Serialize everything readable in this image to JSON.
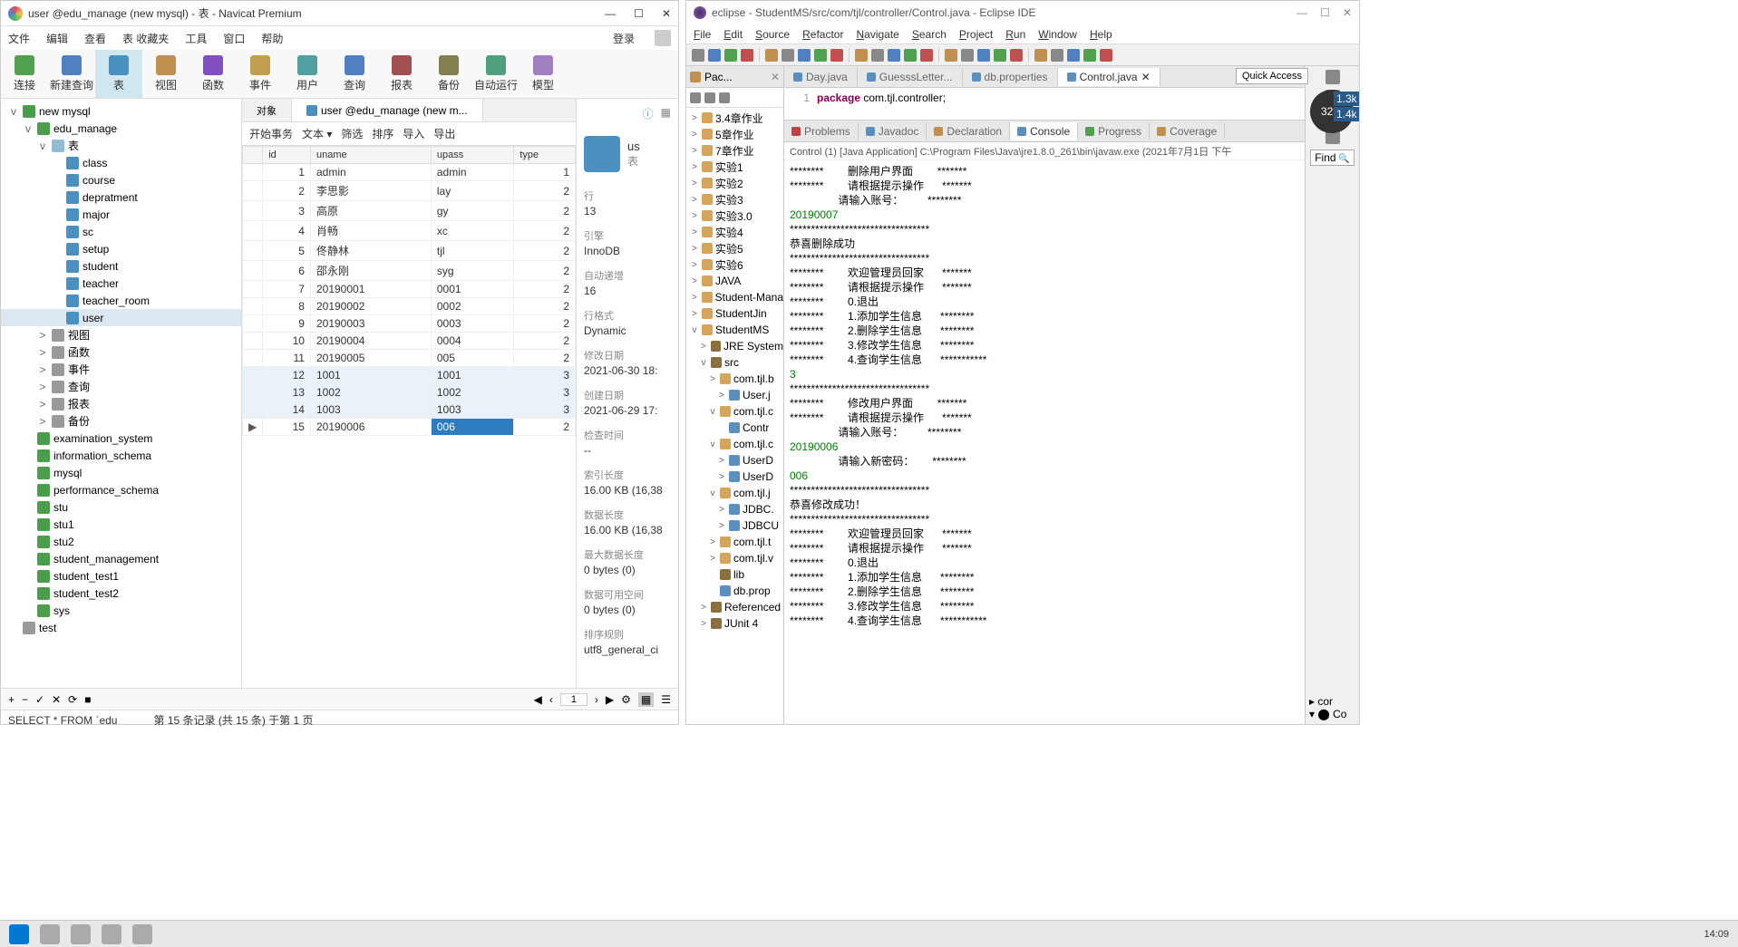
{
  "navicat": {
    "title": "user @edu_manage (new mysql) - 表 - Navicat Premium",
    "menu": [
      "文件",
      "编辑",
      "查看",
      "表 收藏夹",
      "工具",
      "窗口",
      "帮助"
    ],
    "login": "登录",
    "toolbar": [
      {
        "label": "连接"
      },
      {
        "label": "新建查询"
      },
      {
        "label": "表",
        "active": true
      },
      {
        "label": "视图"
      },
      {
        "label": "函数"
      },
      {
        "label": "事件"
      },
      {
        "label": "用户"
      },
      {
        "label": "查询"
      },
      {
        "label": "报表"
      },
      {
        "label": "备份"
      },
      {
        "label": "自动运行"
      },
      {
        "label": "模型"
      }
    ],
    "tree_root": {
      "label": "new mysql",
      "exp": "v"
    },
    "tree_db": {
      "label": "edu_manage",
      "exp": "v"
    },
    "tree_tables_folder": {
      "label": "表",
      "exp": "v"
    },
    "tree_tables": [
      "class",
      "course",
      "depratment",
      "major",
      "sc",
      "setup",
      "student",
      "teacher",
      "teacher_room",
      "user"
    ],
    "tree_selected": "user",
    "tree_groups": [
      "视图",
      "函数",
      "事件",
      "查询",
      "报表",
      "备份"
    ],
    "tree_other_dbs": [
      "examination_system",
      "information_schema",
      "mysql",
      "performance_schema",
      "stu",
      "stu1",
      "stu2",
      "student_management",
      "student_test1",
      "student_test2",
      "sys"
    ],
    "tree_last": "test",
    "center": {
      "tab_obj": "对象",
      "tab_data": "user @edu_manage (new m...",
      "subtb": [
        "开始事务",
        "文本 ▾",
        "筛选",
        "排序",
        "导入",
        "导出"
      ],
      "columns": [
        "id",
        "uname",
        "upass",
        "type"
      ],
      "rows": [
        {
          "id": "1",
          "uname": "admin",
          "upass": "admin",
          "type": "1"
        },
        {
          "id": "2",
          "uname": "李思影",
          "upass": "lay",
          "type": "2"
        },
        {
          "id": "3",
          "uname": "高原",
          "upass": "gy",
          "type": "2"
        },
        {
          "id": "4",
          "uname": "肖畅",
          "upass": "xc",
          "type": "2"
        },
        {
          "id": "5",
          "uname": "佟静林",
          "upass": "tjl",
          "type": "2"
        },
        {
          "id": "6",
          "uname": "邵永刚",
          "upass": "syg",
          "type": "2"
        },
        {
          "id": "7",
          "uname": "20190001",
          "upass": "0001",
          "type": "2"
        },
        {
          "id": "8",
          "uname": "20190002",
          "upass": "0002",
          "type": "2"
        },
        {
          "id": "9",
          "uname": "20190003",
          "upass": "0003",
          "type": "2"
        },
        {
          "id": "10",
          "uname": "20190004",
          "upass": "0004",
          "type": "2"
        },
        {
          "id": "11",
          "uname": "20190005",
          "upass": "005",
          "type": "2"
        },
        {
          "id": "12",
          "uname": "1001",
          "upass": "1001",
          "type": "3"
        },
        {
          "id": "13",
          "uname": "1002",
          "upass": "1002",
          "type": "3"
        },
        {
          "id": "14",
          "uname": "1003",
          "upass": "1003",
          "type": "3"
        },
        {
          "id": "15",
          "uname": "20190006",
          "upass": "006",
          "type": "2"
        }
      ],
      "highlight_rows": [
        11,
        12,
        13
      ],
      "pointer_row": 14,
      "sel_cell": {
        "row": 14,
        "col": "upass"
      }
    },
    "right": {
      "title": "us",
      "sublabel": "表",
      "props": [
        {
          "lbl": "行",
          "val": "13"
        },
        {
          "lbl": "引擎",
          "val": "InnoDB"
        },
        {
          "lbl": "自动递增",
          "val": "16"
        },
        {
          "lbl": "行格式",
          "val": "Dynamic"
        },
        {
          "lbl": "修改日期",
          "val": "2021-06-30 18:"
        },
        {
          "lbl": "创建日期",
          "val": "2021-06-29 17:"
        },
        {
          "lbl": "检查时间",
          "val": "--"
        },
        {
          "lbl": "索引长度",
          "val": "16.00 KB (16,38"
        },
        {
          "lbl": "数据长度",
          "val": "16.00 KB (16,38"
        },
        {
          "lbl": "最大数据长度",
          "val": "0 bytes (0)"
        },
        {
          "lbl": "数据可用空间",
          "val": "0 bytes (0)"
        },
        {
          "lbl": "排序规则",
          "val": "utf8_general_ci"
        }
      ]
    },
    "bottom": {
      "page": "1"
    },
    "status": {
      "sql": "SELECT * FROM `edu",
      "info": "第 15 条记录 (共 15 条) 于第 1 页"
    }
  },
  "eclipse": {
    "title": "eclipse - StudentMS/src/com/tjl/controller/Control.java - Eclipse IDE",
    "menu": [
      "File",
      "Edit",
      "Source",
      "Refactor",
      "Navigate",
      "Search",
      "Project",
      "Run",
      "Window",
      "Help"
    ],
    "quick_access": "Quick Access",
    "lpanel": {
      "tab": "Pac..."
    },
    "etree": [
      {
        "lvl": 0,
        "exp": ">",
        "label": "3.4章作业",
        "icon": "pkg"
      },
      {
        "lvl": 0,
        "exp": ">",
        "label": "5章作业",
        "icon": "pkg"
      },
      {
        "lvl": 0,
        "exp": ">",
        "label": "7章作业",
        "icon": "pkg"
      },
      {
        "lvl": 0,
        "exp": ">",
        "label": "实验1",
        "icon": "pkg"
      },
      {
        "lvl": 0,
        "exp": ">",
        "label": "实验2",
        "icon": "pkg"
      },
      {
        "lvl": 0,
        "exp": ">",
        "label": "实验3",
        "icon": "pkg"
      },
      {
        "lvl": 0,
        "exp": ">",
        "label": "实验3.0",
        "icon": "pkg"
      },
      {
        "lvl": 0,
        "exp": ">",
        "label": "实验4",
        "icon": "pkg"
      },
      {
        "lvl": 0,
        "exp": ">",
        "label": "实验5",
        "icon": "pkg"
      },
      {
        "lvl": 0,
        "exp": ">",
        "label": "实验6",
        "icon": "pkg"
      },
      {
        "lvl": 0,
        "exp": ">",
        "label": "JAVA",
        "icon": "pkg"
      },
      {
        "lvl": 0,
        "exp": ">",
        "label": "Student-Mana",
        "icon": "pkg"
      },
      {
        "lvl": 0,
        "exp": ">",
        "label": "StudentJin",
        "icon": "pkg"
      },
      {
        "lvl": 0,
        "exp": "v",
        "label": "StudentMS",
        "icon": "pkg"
      },
      {
        "lvl": 1,
        "exp": ">",
        "label": "JRE System",
        "icon": "src"
      },
      {
        "lvl": 1,
        "exp": "v",
        "label": "src",
        "icon": "src"
      },
      {
        "lvl": 2,
        "exp": ">",
        "label": "com.tjl.b",
        "icon": "pkg"
      },
      {
        "lvl": 3,
        "exp": ">",
        "label": "User.j",
        "icon": "cls"
      },
      {
        "lvl": 2,
        "exp": "v",
        "label": "com.tjl.c",
        "icon": "pkg"
      },
      {
        "lvl": 3,
        "exp": "",
        "label": "Contr",
        "icon": "cls"
      },
      {
        "lvl": 2,
        "exp": "v",
        "label": "com.tjl.c",
        "icon": "pkg"
      },
      {
        "lvl": 3,
        "exp": ">",
        "label": "UserD",
        "icon": "cls"
      },
      {
        "lvl": 3,
        "exp": ">",
        "label": "UserD",
        "icon": "cls"
      },
      {
        "lvl": 2,
        "exp": "v",
        "label": "com.tjl.j",
        "icon": "pkg"
      },
      {
        "lvl": 3,
        "exp": ">",
        "label": "JDBC.",
        "icon": "cls"
      },
      {
        "lvl": 3,
        "exp": ">",
        "label": "JDBCU",
        "icon": "cls"
      },
      {
        "lvl": 2,
        "exp": ">",
        "label": "com.tjl.t",
        "icon": "pkg"
      },
      {
        "lvl": 2,
        "exp": ">",
        "label": "com.tjl.v",
        "icon": "pkg"
      },
      {
        "lvl": 2,
        "exp": "",
        "label": "lib",
        "icon": "src"
      },
      {
        "lvl": 2,
        "exp": "",
        "label": "db.prop",
        "icon": "cls"
      },
      {
        "lvl": 1,
        "exp": ">",
        "label": "Referenced",
        "icon": "src"
      },
      {
        "lvl": 1,
        "exp": ">",
        "label": "JUnit 4",
        "icon": "src"
      }
    ],
    "ed_tabs": [
      {
        "label": "Day.java"
      },
      {
        "label": "GuesssLetter..."
      },
      {
        "label": "db.properties"
      },
      {
        "label": "Control.java",
        "active": true
      }
    ],
    "editor_line_no": "1",
    "editor_kw": "package",
    "editor_rest": " com.tjl.controller;",
    "con_tabs": [
      {
        "label": "Problems",
        "color": "#c04040"
      },
      {
        "label": "Javadoc",
        "color": "#5a8fc0"
      },
      {
        "label": "Declaration",
        "color": "#c09050"
      },
      {
        "label": "Console",
        "color": "#5a8fc0",
        "active": true
      },
      {
        "label": "Progress",
        "color": "#50a050"
      },
      {
        "label": "Coverage",
        "color": "#c09050"
      }
    ],
    "con_header": "Control (1) [Java Application] C:\\Program Files\\Java\\jre1.8.0_261\\bin\\javaw.exe (2021年7月1日 下午",
    "console_lines": [
      {
        "t": "********        删除用户界面        *******"
      },
      {
        "t": "********        请根据提示操作      *******"
      },
      {
        "t": "                请输入账号：        ********"
      },
      {
        "t": "20190007",
        "cls": "inp"
      },
      {
        "t": "*********************************"
      },
      {
        "t": ""
      },
      {
        "t": "恭喜删除成功"
      },
      {
        "t": "*********************************"
      },
      {
        "t": "********        欢迎管理员回家      *******"
      },
      {
        "t": "********        请根据提示操作      *******"
      },
      {
        "t": "********        0.退出"
      },
      {
        "t": "********        1.添加学生信息      ********"
      },
      {
        "t": "********        2.删除学生信息      ********"
      },
      {
        "t": "********        3.修改学生信息      ********"
      },
      {
        "t": "********        4.查询学生信息      ***********"
      },
      {
        "t": "3",
        "cls": "inp"
      },
      {
        "t": "*********************************"
      },
      {
        "t": "********        修改用户界面        *******"
      },
      {
        "t": "********        请根据提示操作      *******"
      },
      {
        "t": "                请输入账号：        ********"
      },
      {
        "t": "20190006",
        "cls": "inp"
      },
      {
        "t": "                请输入新密码：      ********"
      },
      {
        "t": "006",
        "cls": "inp"
      },
      {
        "t": "*********************************"
      },
      {
        "t": "恭喜修改成功！"
      },
      {
        "t": "*********************************"
      },
      {
        "t": "********        欢迎管理员回家      *******"
      },
      {
        "t": "********        请根据提示操作      *******"
      },
      {
        "t": "********        0.退出"
      },
      {
        "t": "********        1.添加学生信息      ********"
      },
      {
        "t": "********        2.删除学生信息      ********"
      },
      {
        "t": "********        3.修改学生信息      ********"
      },
      {
        "t": "********        4.查询学生信息      ***********"
      }
    ],
    "find_label": "Find",
    "badge": "32%",
    "right_bars": [
      "1.3k",
      "1.4k"
    ],
    "right_tree": [
      "cor",
      "Co"
    ]
  },
  "taskbar": {
    "time": "14:09"
  }
}
